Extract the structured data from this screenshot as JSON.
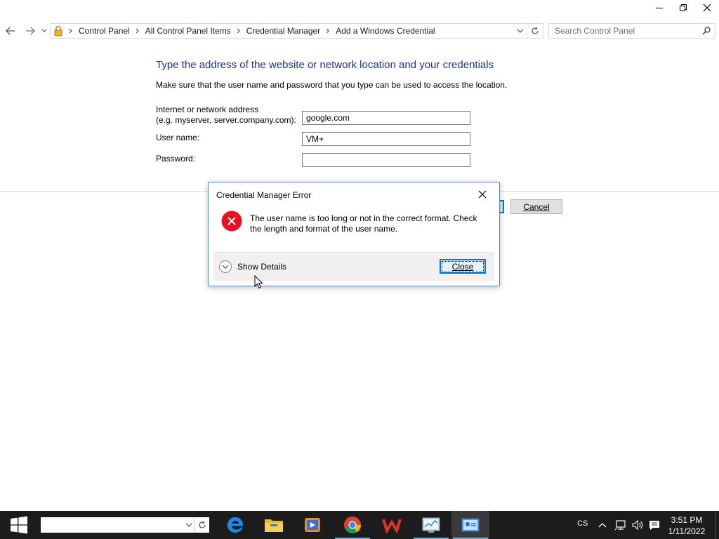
{
  "window": {
    "controls": [
      "minimize",
      "restore",
      "close"
    ]
  },
  "address_bar": {
    "icon": "credential-lock-icon",
    "breadcrumbs": [
      "Control Panel",
      "All Control Panel Items",
      "Credential Manager",
      "Add a Windows Credential"
    ]
  },
  "search": {
    "placeholder": "Search Control Panel"
  },
  "form": {
    "heading": "Type the address of the website or network location and your credentials",
    "subtext": "Make sure that the user name and password that you type can be used to access the location.",
    "address_label_line1": "Internet or network address",
    "address_label_line2": "(e.g. myserver, server.company.com):",
    "address_value": "google.com",
    "username_label": "User name:",
    "username_value": "VM+",
    "password_label": "Password:",
    "password_value": "",
    "cancel_label": "Cancel"
  },
  "dialog": {
    "title": "Credential Manager Error",
    "message": "The user name is too long or not in the correct format. Check the length and format of the user name.",
    "details_label": "Show Details",
    "close_label": "Close",
    "error_color": "#e81123"
  },
  "taskbar": {
    "apps": [
      "edge-icon",
      "file-explorer-icon",
      "media-player-icon",
      "chrome-icon",
      "wps-office-icon",
      "performance-monitor-icon",
      "credential-manager-icon"
    ],
    "language": "CS",
    "time": "3:51 PM",
    "date": "1/11/2022"
  }
}
